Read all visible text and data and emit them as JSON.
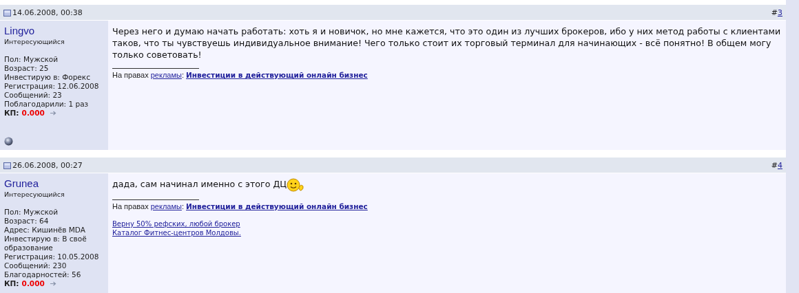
{
  "posts": [
    {
      "date": "14.06.2008, 00:38",
      "hash": "#",
      "number": "3",
      "user": {
        "name": "Lingvo",
        "title": "Интересующийся",
        "details": [
          "Пол: Мужской",
          "Возраст: 25",
          "Инвестирую в: Форекс",
          "Регистрация: 12.06.2008",
          "Сообщений: 23",
          "Поблагодарили: 1 раз"
        ],
        "kp_label": "КП:",
        "kp_value": "0.000"
      },
      "status_icon": true,
      "message": "Через него и думаю начать работать: хоть я и новичок, но мне кажется, что это один из лучших брокеров, ибо у них метод работы с клиентами таков, что ты чувствуешь индивидуальное внимание! Чего только стоит их торговый терминал для начинающих - всё понятно! В общем могу только советовать!",
      "smiley": false,
      "ad": {
        "prefix": "На правах",
        "link": "рекламы",
        "colon": ":",
        "title": "Инвестиции в действующий онлайн бизнес"
      }
    },
    {
      "date": "26.06.2008, 00:27",
      "hash": "#",
      "number": "4",
      "user": {
        "name": "Grunea",
        "title": "Интересующийся",
        "details": [
          "Пол: Мужской",
          "Возраст: 64",
          "Адрес: Кишинёв MDA",
          "Инвестирую в: В своё образование",
          "Регистрация: 10.05.2008",
          "Сообщений: 230",
          "Благодарностей: 56"
        ],
        "kp_label": "КП:",
        "kp_value": "0.000"
      },
      "status_icon": false,
      "message": "дада, сам начинал именно с этого ДЦ",
      "smiley": true,
      "ad": {
        "prefix": "На правах",
        "link": "рекламы",
        "colon": ":",
        "title": "Инвестиции в действующий онлайн бизнес"
      },
      "signature_links": [
        "Верну 50% рефских, любой брокер",
        "Каталог Фитнес-центров Молдовы."
      ]
    }
  ]
}
